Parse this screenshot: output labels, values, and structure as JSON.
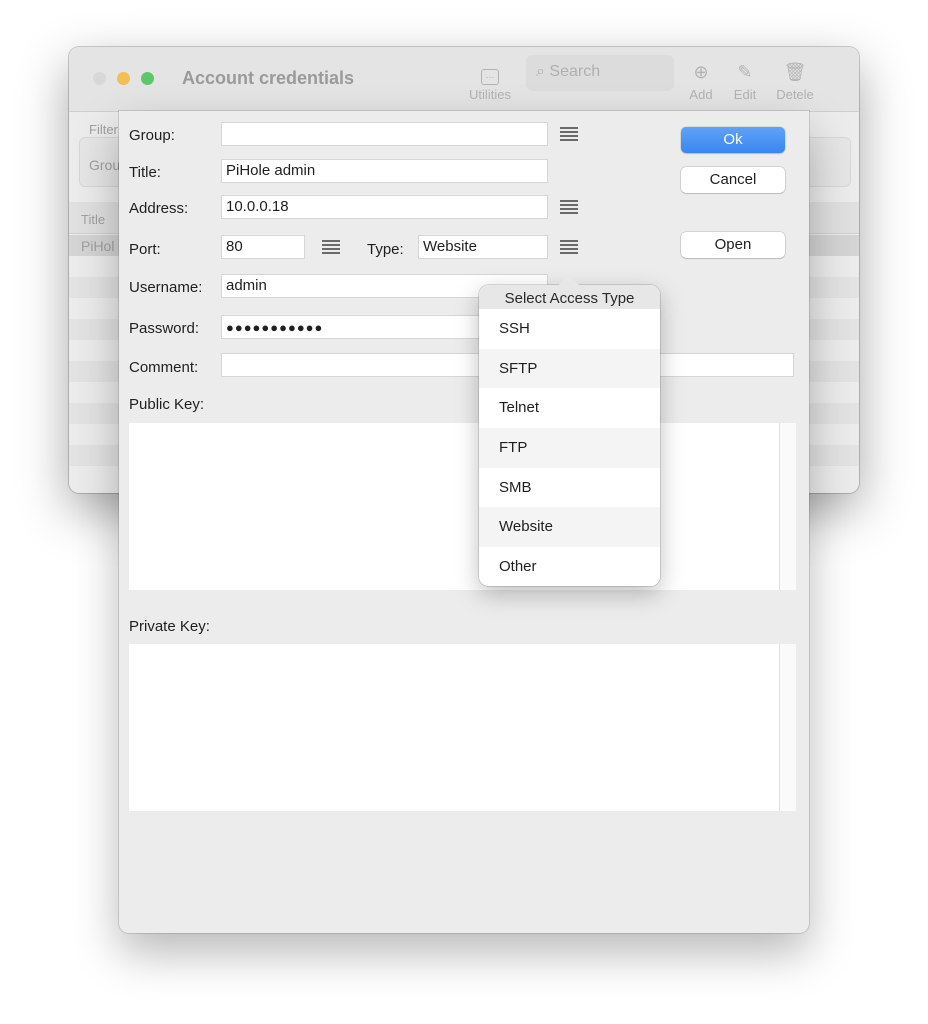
{
  "window": {
    "title": "Account credentials",
    "toolbar": {
      "utilities_label": "Utilities",
      "search_placeholder": "Search",
      "add_label": "Add",
      "edit_label": "Edit",
      "delete_label": "Detele"
    },
    "filter_label": "Filter",
    "group_label": "Grou",
    "list_header_title": "Title",
    "selected_row_text": "PiHol"
  },
  "form": {
    "group_label": "Group:",
    "group_value": "",
    "title_label": "Title:",
    "title_value": "PiHole admin",
    "address_label": "Address:",
    "address_value": "10.0.0.18",
    "port_label": "Port:",
    "port_value": "80",
    "type_label": "Type:",
    "type_value": "Website",
    "username_label": "Username:",
    "username_value": "admin",
    "password_label": "Password:",
    "password_value": "●●●●●●●●●●●",
    "comment_label": "Comment:",
    "comment_value": "",
    "public_key_label": "Public Key:",
    "private_key_label": "Private Key:"
  },
  "buttons": {
    "ok": "Ok",
    "cancel": "Cancel",
    "open": "Open"
  },
  "popup": {
    "header": "Select Access Type",
    "items": [
      "SSH",
      "SFTP",
      "Telnet",
      "FTP",
      "SMB",
      "Website",
      "Other"
    ]
  },
  "colors": {
    "accent": "#3a86f0",
    "traffic_close": "#d8d8d8",
    "traffic_minimize": "#f2bf55",
    "traffic_maximize": "#5ec76b"
  }
}
